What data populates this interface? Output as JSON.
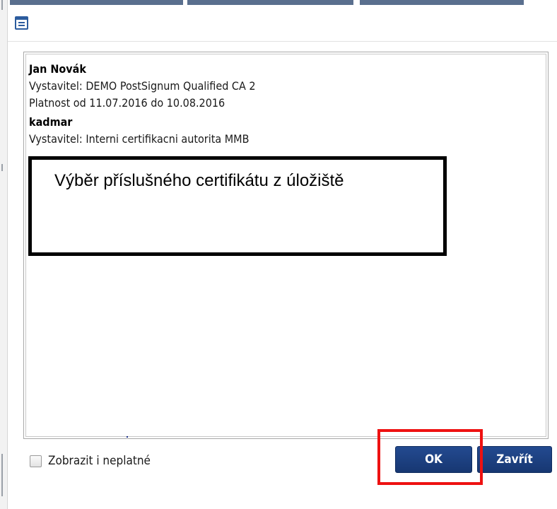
{
  "certificates": [
    {
      "name": "Jan Novák",
      "issuer": "Vystavitel: DEMO PostSignum Qualified CA 2",
      "validity": "Platnost od 11.07.2016 do 10.08.2016"
    },
    {
      "name": "kadmar",
      "issuer": "Vystavitel: Interni certifikacni autorita MMB"
    }
  ],
  "callout": {
    "text": "Výběr příslušného certifikátu z úložiště"
  },
  "options": {
    "show_invalid_label": "Zobrazit i neplatné"
  },
  "buttons": {
    "ok": "OK",
    "close": "Zavřít"
  },
  "icons": {
    "window": "dialog-window-icon"
  },
  "colors": {
    "button": "#1e4282",
    "highlight": "#ee1111",
    "top_bar": "#5a6f8e"
  }
}
